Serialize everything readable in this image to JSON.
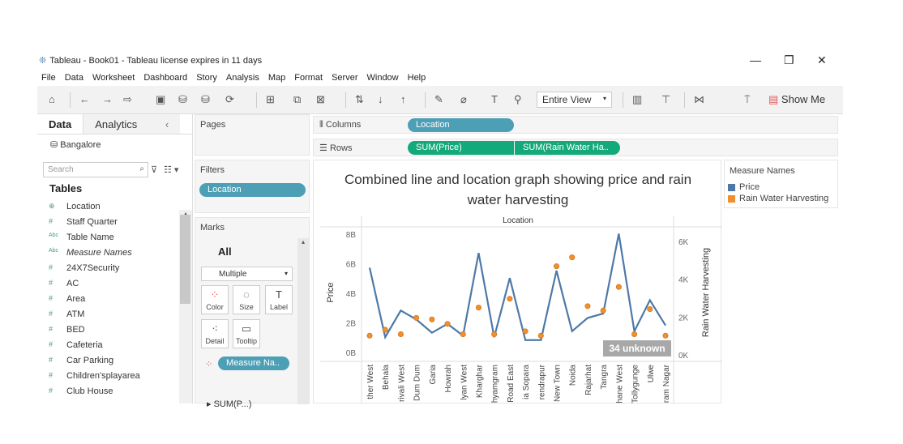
{
  "window": {
    "title": "Tableau - Book01 - Tableau license expires in 11 days"
  },
  "menu": [
    "File",
    "Data",
    "Worksheet",
    "Dashboard",
    "Story",
    "Analysis",
    "Map",
    "Format",
    "Server",
    "Window",
    "Help"
  ],
  "toolbar": {
    "view": "Entire View",
    "show_me": "Show Me"
  },
  "left": {
    "tab_data": "Data",
    "tab_analytics": "Analytics",
    "datasource": "Bangalore",
    "search_placeholder": "Search",
    "tables_label": "Tables",
    "fields": [
      {
        "icon": "⊕",
        "name": "Location"
      },
      {
        "icon": "#",
        "name": "Staff Quarter"
      },
      {
        "icon": "Abc",
        "name": "Table Name"
      },
      {
        "icon": "Abc",
        "name": "Measure Names"
      },
      {
        "icon": "#",
        "name": "24X7Security"
      },
      {
        "icon": "#",
        "name": "AC"
      },
      {
        "icon": "#",
        "name": "Area"
      },
      {
        "icon": "#",
        "name": "ATM"
      },
      {
        "icon": "#",
        "name": "BED"
      },
      {
        "icon": "#",
        "name": "Cafeteria"
      },
      {
        "icon": "#",
        "name": "Car Parking"
      },
      {
        "icon": "#",
        "name": "Children'splayarea"
      },
      {
        "icon": "#",
        "name": "Club House"
      }
    ]
  },
  "cards": {
    "pages": "Pages",
    "filters": "Filters",
    "filter_pill": "Location",
    "marks": "Marks",
    "marks_all": "All",
    "mark_type": "Multiple",
    "buttons": [
      "Color",
      "Size",
      "Label",
      "Detail",
      "Tooltip"
    ],
    "measure_pill": "Measure Na..",
    "sum_partial": "SUM(P...)"
  },
  "shelves": {
    "columns_label": "Columns",
    "columns_pill": "Location",
    "rows_label": "Rows",
    "rows_pill1": "SUM(Price)",
    "rows_pill2": "SUM(Rain Water Ha.."
  },
  "legend": {
    "title": "Measure Names",
    "items": [
      {
        "name": "Price",
        "color": "#4e79a7"
      },
      {
        "name": "Rain Water Harvesting",
        "color": "#f28e2b"
      }
    ]
  },
  "chart_data": {
    "type": "line",
    "title": "Combined line and location graph showing price and rain water harvesting",
    "header": "Location",
    "ylabel": "Price",
    "y2label": "Rain Water Harvesting",
    "yticks": [
      "8B",
      "6B",
      "4B",
      "2B",
      "0B"
    ],
    "y2ticks": [
      "6K",
      "4K",
      "2K",
      "0K"
    ],
    "ylim": [
      0,
      8.5
    ],
    "y2lim": [
      0,
      6
    ],
    "unknown_badge": "34 unknown",
    "categories": [
      "ther West",
      "Behala",
      "rivali West",
      "Dum Dum",
      "Garia",
      "Howrah",
      "lyan West",
      "Kharghar",
      "hyamgram",
      "Road East",
      "ia Sopara",
      "rendrapur",
      "New Town",
      "Noida",
      "Rajarhat",
      "Tangra",
      "hane West",
      "Tollygunge",
      "Ulwe",
      "ram Nagar"
    ],
    "series": [
      {
        "name": "Price",
        "color": "#4e79a7",
        "mark": "line",
        "values": [
          5.9,
          1.2,
          3.0,
          2.4,
          1.5,
          2.1,
          1.3,
          6.9,
          1.2,
          5.2,
          1.0,
          1.0,
          5.7,
          1.6,
          2.5,
          2.8,
          8.2,
          1.6,
          3.7,
          2.0
        ]
      },
      {
        "name": "Rain Water Harvesting",
        "color": "#f28e2b",
        "mark": "dot",
        "values": [
          1.3,
          1.7,
          1.4,
          2.5,
          2.4,
          2.1,
          1.4,
          3.2,
          1.4,
          3.8,
          1.6,
          1.3,
          6.0,
          6.6,
          3.3,
          3.0,
          4.6,
          1.4,
          3.1,
          1.3
        ]
      }
    ]
  }
}
